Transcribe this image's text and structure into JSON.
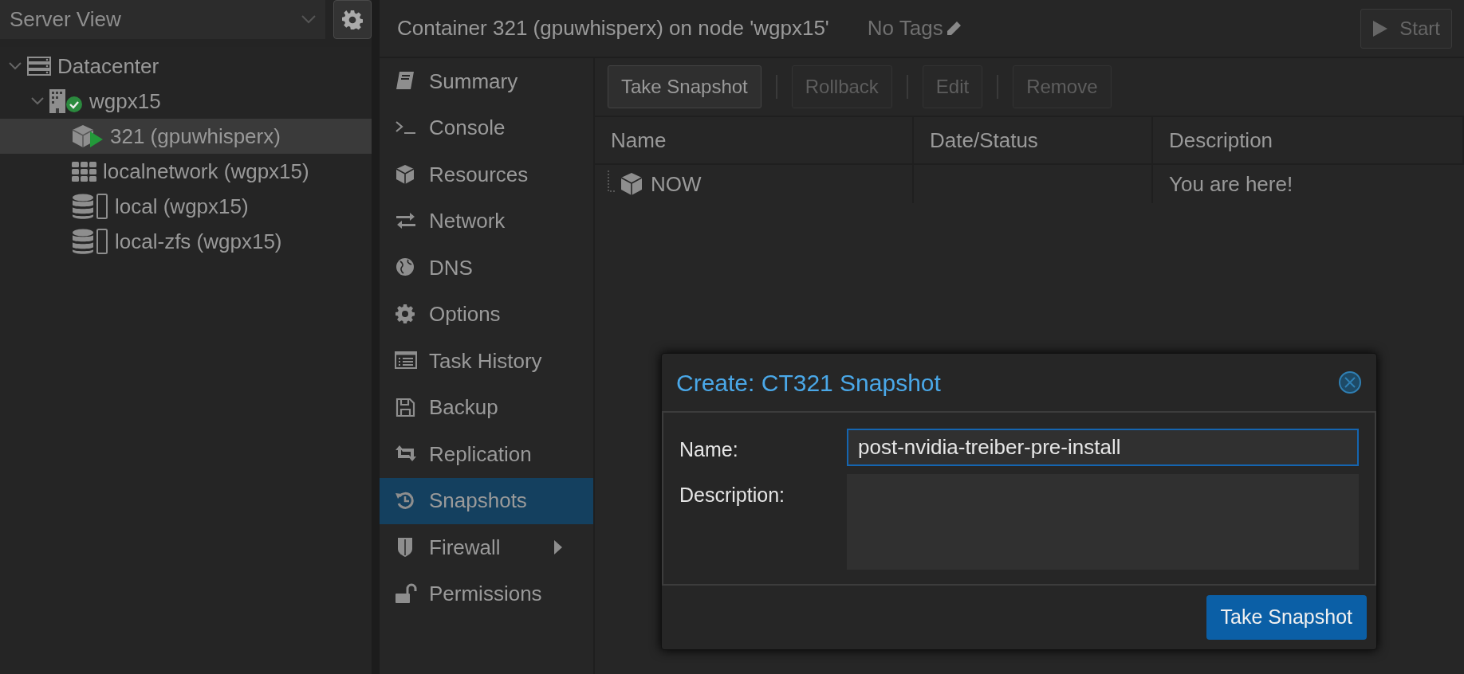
{
  "resource_panel": {
    "view_selector": {
      "value": "Server View"
    },
    "tree": [
      {
        "kind": "datacenter",
        "label": "Datacenter",
        "expanded": true,
        "selected": false,
        "children": [
          {
            "kind": "node",
            "label": "wgpx15",
            "expanded": true,
            "selected": false,
            "online": true,
            "children": [
              {
                "kind": "container",
                "label": "321 (gpuwhisperx)",
                "selected": true,
                "running": true
              },
              {
                "kind": "sdn",
                "label": "localnetwork (wgpx15)",
                "selected": false
              },
              {
                "kind": "storage",
                "label": "local (wgpx15)",
                "selected": false
              },
              {
                "kind": "storage",
                "label": "local-zfs (wgpx15)",
                "selected": false
              }
            ]
          }
        ]
      }
    ]
  },
  "header": {
    "title": "Container 321 (gpuwhisperx) on node 'wgpx15'",
    "tags": "No Tags",
    "start_button": {
      "label": "Start",
      "disabled": true
    }
  },
  "nav": [
    {
      "kind": "summary",
      "label": "Summary",
      "selected": false
    },
    {
      "kind": "console",
      "label": "Console",
      "selected": false
    },
    {
      "kind": "resources",
      "label": "Resources",
      "selected": false
    },
    {
      "kind": "network",
      "label": "Network",
      "selected": false
    },
    {
      "kind": "dns",
      "label": "DNS",
      "selected": false
    },
    {
      "kind": "options",
      "label": "Options",
      "selected": false
    },
    {
      "kind": "tasks",
      "label": "Task History",
      "selected": false
    },
    {
      "kind": "backup",
      "label": "Backup",
      "selected": false
    },
    {
      "kind": "replication",
      "label": "Replication",
      "selected": false
    },
    {
      "kind": "snapshots",
      "label": "Snapshots",
      "selected": true
    },
    {
      "kind": "firewall",
      "label": "Firewall",
      "selected": false,
      "has_submenu": true
    },
    {
      "kind": "permissions",
      "label": "Permissions",
      "selected": false
    }
  ],
  "toolbar": [
    {
      "label": "Take Snapshot",
      "disabled": false
    },
    {
      "label": "Rollback",
      "disabled": true
    },
    {
      "label": "Edit",
      "disabled": true
    },
    {
      "label": "Remove",
      "disabled": true
    }
  ],
  "table": {
    "columns": [
      "Name",
      "Date/Status",
      "Description"
    ],
    "rows": [
      {
        "name": "NOW",
        "description": "You are here!"
      }
    ]
  },
  "dialog": {
    "title": "Create: CT321 Snapshot",
    "fields": [
      {
        "kind": "text",
        "label": "Name:",
        "value": "post-nvidia-treiber-pre-install",
        "focused": true
      },
      {
        "kind": "textarea",
        "label": "Description:",
        "focused": false
      }
    ],
    "submit": "Take Snapshot"
  }
}
